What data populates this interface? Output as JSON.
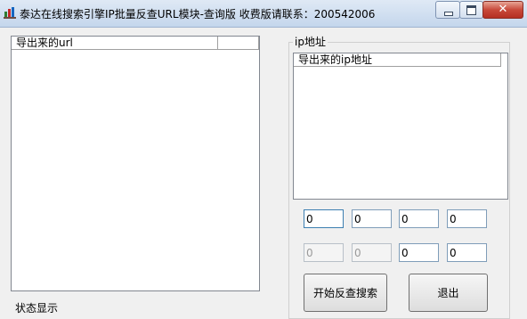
{
  "window": {
    "title": "泰达在线搜索引擎IP批量反查URL模块-查询版 收费版请联系：200542006",
    "close_glyph": "✕"
  },
  "url_list": {
    "columns": [
      "导出来的url",
      ""
    ]
  },
  "ip_group": {
    "label": "ip地址",
    "list_columns": [
      "导出来的ip地址"
    ],
    "start_ip": [
      "0",
      "0",
      "0",
      "0"
    ],
    "end_ip": [
      "0",
      "0",
      "0",
      "0"
    ]
  },
  "buttons": {
    "search": "开始反查搜索",
    "exit": "退出"
  },
  "status": {
    "text": "状态显示"
  }
}
